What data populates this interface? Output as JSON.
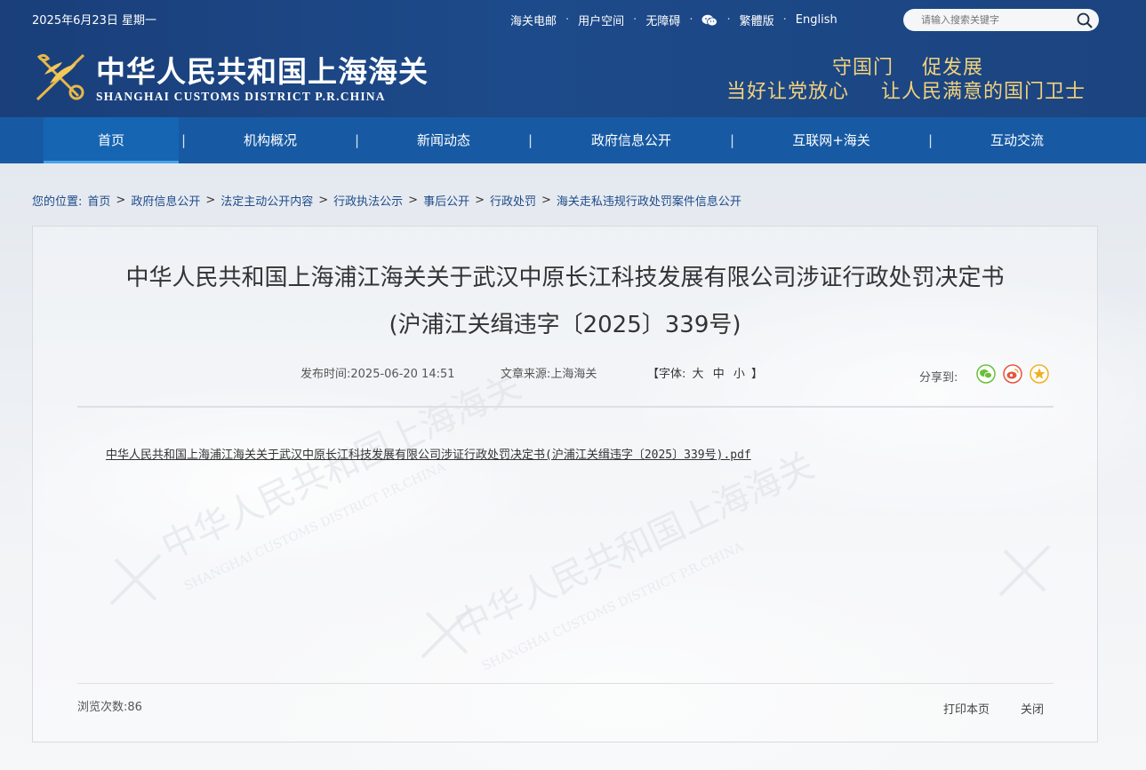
{
  "header": {
    "date": "2025年6月23日 星期一",
    "top_links": [
      "海关电邮",
      "用户空间",
      "无障碍"
    ],
    "wechat_icon": "wechat-icon",
    "traditional_label": "繁體版",
    "english_label": "English",
    "search_placeholder": "请输入搜索关键字",
    "logo_cn": "中华人民共和国上海海关",
    "logo_en": "SHANGHAI CUSTOMS DISTRICT P.R.CHINA",
    "slogan_line1": [
      "守国门",
      "促发展"
    ],
    "slogan_line2": [
      "当好让党放心",
      "让人民满意的国门卫士"
    ]
  },
  "nav": {
    "items": [
      "首页",
      "机构概况",
      "新闻动态",
      "政府信息公开",
      "互联网+海关",
      "互动交流"
    ],
    "separator": "|"
  },
  "breadcrumb": {
    "label": "您的位置:",
    "items": [
      "首页",
      "政府信息公开",
      "法定主动公开内容",
      "行政执法公示",
      "事后公开",
      "行政处罚",
      "海关走私违规行政处罚案件信息公开"
    ],
    "separator": ">"
  },
  "article": {
    "title_line1": "中华人民共和国上海浦江海关关于武汉中原长江科技发展有限公司涉证行政处罚决定书",
    "title_line2": "(沪浦江关缉违字〔2025〕339号)",
    "publish_time": "发布时间:2025-06-20 14:51",
    "source": "文章来源:上海海关",
    "font_label": "【字体:",
    "font_large": "大",
    "font_medium": "中",
    "font_small": "小",
    "font_end": "】",
    "share_label": "分享到:",
    "share_icons": [
      "wechat-share-icon",
      "weibo-share-icon",
      "favorite-share-icon"
    ],
    "attachment": "中华人民共和国上海浦江海关关于武汉中原长江科技发展有限公司涉证行政处罚决定书(沪浦江关缉违字〔2025〕339号).pdf",
    "views": "浏览次数:86",
    "print_label": "打印本页",
    "close_label": "关闭"
  },
  "colors": {
    "header_bg": "#1d4a8a",
    "nav_bg": "#175aa3",
    "slogan": "#f3d27a",
    "link": "#1d4a8a"
  }
}
